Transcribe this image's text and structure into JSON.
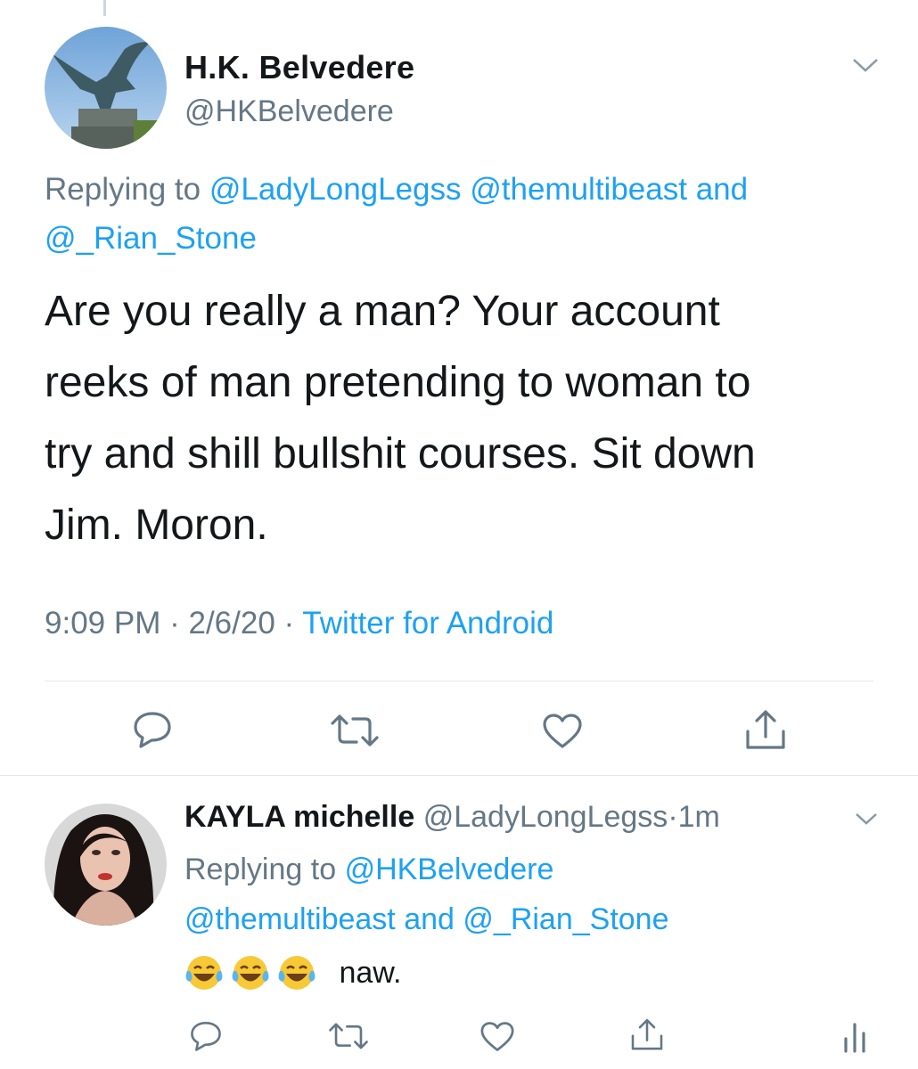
{
  "tweet": {
    "author_name": "H.K. Belvedere",
    "author_handle": "@HKBelvedere",
    "replying_prefix": "Replying to",
    "replying_mentions_1": "@LadyLongLegss @themultibeast",
    "replying_and": "and",
    "replying_mentions_2": "@_Rian_Stone",
    "text_lines": [
      "Are you really a man? Your account",
      "reeks of man pretending to woman to",
      "try and shill bullshit courses. Sit down",
      "Jim. Moron."
    ],
    "time": "9:09 PM",
    "date": "2/6/20",
    "separator": "·",
    "source": "Twitter for Android",
    "actions": [
      "reply-icon",
      "retweet-icon",
      "like-icon",
      "share-icon"
    ]
  },
  "reply": {
    "author_name": "KAYLA michelle",
    "author_handle": "@LadyLongLegss",
    "separator": "·",
    "age": "1m",
    "replying_prefix": "Replying to",
    "replying_mention_1": "@HKBelvedere",
    "replying_mention_2": "@themultibeast",
    "replying_and": "and",
    "replying_mention_3": "@_Rian_Stone",
    "emojis": [
      "face-with-tears-of-joy",
      "face-with-tears-of-joy",
      "face-with-tears-of-joy"
    ],
    "text": "naw.",
    "actions": [
      "reply-icon",
      "retweet-icon",
      "like-icon",
      "share-icon",
      "analytics-icon"
    ]
  },
  "colors": {
    "link": "#1da1f2",
    "secondary": "#657786",
    "divider": "#e1e8ed",
    "text": "#14171a"
  }
}
